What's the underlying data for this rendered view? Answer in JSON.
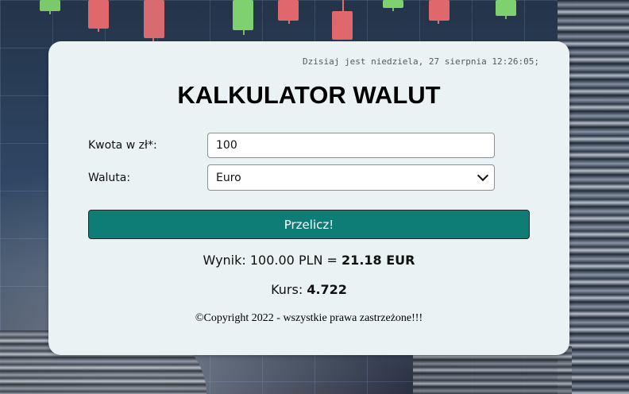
{
  "header": {
    "datetime": "Dzisiaj jest niedziela, 27 sierpnia 12:26:05;",
    "title": "KALKULATOR WALUT"
  },
  "form": {
    "amount_label": "Kwota w zł*:",
    "amount_value": "100",
    "currency_label": "Waluta:",
    "currency_selected": "Euro",
    "submit_label": "Przelicz!"
  },
  "result": {
    "prefix": "Wynik: 100.00 PLN = ",
    "value": "21.18 EUR",
    "rate_prefix": "Kurs: ",
    "rate_value": "4.722"
  },
  "footer": {
    "copyright": "©Copyright 2022 - wszystkie prawa zastrzeżone!!!"
  },
  "colors": {
    "card_background": "#eaf2f3",
    "button_background": "#0e7d76",
    "button_text": "#ffffff"
  }
}
